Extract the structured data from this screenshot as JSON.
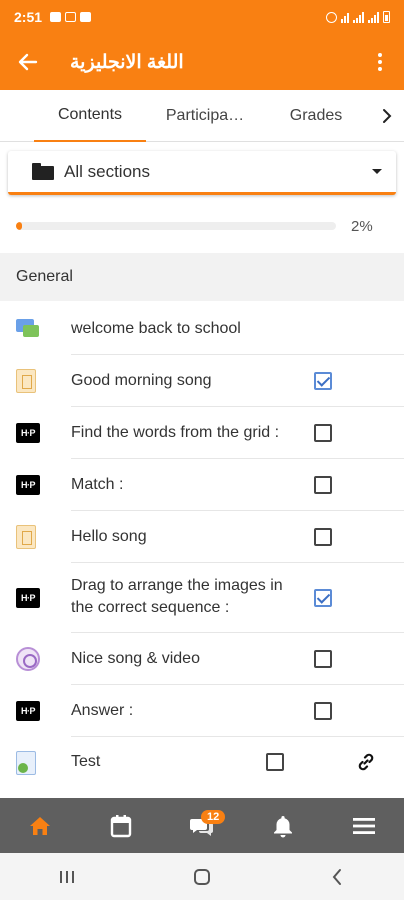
{
  "status_bar": {
    "time": "2:51"
  },
  "app_bar": {
    "title": "اللغة الانجليزية"
  },
  "tabs": [
    {
      "label": "Contents",
      "active": true
    },
    {
      "label": "Participa…",
      "active": false
    },
    {
      "label": "Grades",
      "active": false
    }
  ],
  "section_select": {
    "label": "All sections"
  },
  "progress": {
    "value": 0.02,
    "label": "2%"
  },
  "section": {
    "title": "General"
  },
  "modules": [
    {
      "icon": "forum-icon",
      "text": "welcome back to school",
      "completion": "none"
    },
    {
      "icon": "page-icon",
      "text": "Good morning song",
      "completion": "checked"
    },
    {
      "icon": "h5p-icon",
      "text": "Find the words from the grid :",
      "completion": "unchecked"
    },
    {
      "icon": "h5p-icon",
      "text": "Match :",
      "completion": "unchecked"
    },
    {
      "icon": "page-icon",
      "text": "Hello song",
      "completion": "unchecked"
    },
    {
      "icon": "h5p-icon",
      "text_line1": "Drag to arrange the images in",
      "text_line2": "the correct sequence :",
      "completion": "checked"
    },
    {
      "icon": "video-icon",
      "text": "Nice song & video",
      "completion": "unchecked"
    },
    {
      "icon": "h5p-icon",
      "text": "Answer :",
      "completion": "unchecked"
    },
    {
      "icon": "quiz-icon",
      "text": "Test",
      "completion": "unchecked",
      "extra_icon": "link-icon"
    }
  ],
  "h5p_label": "H·P",
  "bottom_nav": {
    "items": [
      "home-icon",
      "calendar-icon",
      "messages-icon",
      "notifications-icon",
      "menu-icon"
    ],
    "messages_badge": "12"
  },
  "colors": {
    "accent": "#f98012",
    "bottom_nav_bg": "#5f5f5f",
    "check_blue": "#3c6fc4"
  }
}
